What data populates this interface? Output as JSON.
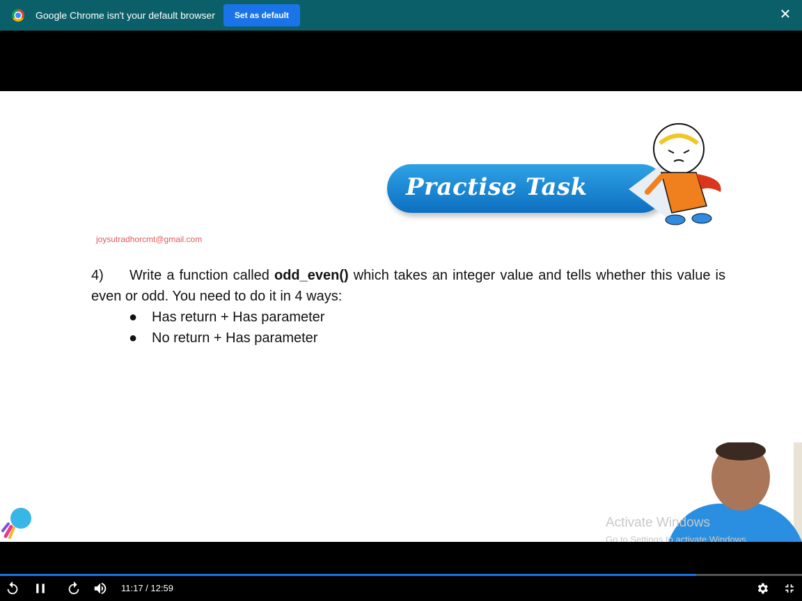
{
  "infobar": {
    "message": "Google Chrome isn't your default browser",
    "button_label": "Set as default",
    "close_icon": "close-icon"
  },
  "slide": {
    "banner_title": "Practise Task",
    "email": "joysutradhorcmt@gmail.com",
    "task_number": "4)",
    "task_text_before": "Write a function called ",
    "task_function": "odd_even()",
    "task_text_after": " which takes an integer value and tells whether this value is even or odd. You need to do it in 4 ways:",
    "bullets": [
      "Has return + Has parameter",
      "No return + Has parameter"
    ],
    "watermark_title": "Activate Windows",
    "watermark_subtitle": "Go to Settings to activate Windows."
  },
  "player": {
    "time": "11:17 / 12:59",
    "progress": 0.868,
    "icons": [
      "replay-icon",
      "pause-icon",
      "forward-icon",
      "volume-icon",
      "settings-icon",
      "exit-fullscreen-icon"
    ]
  }
}
